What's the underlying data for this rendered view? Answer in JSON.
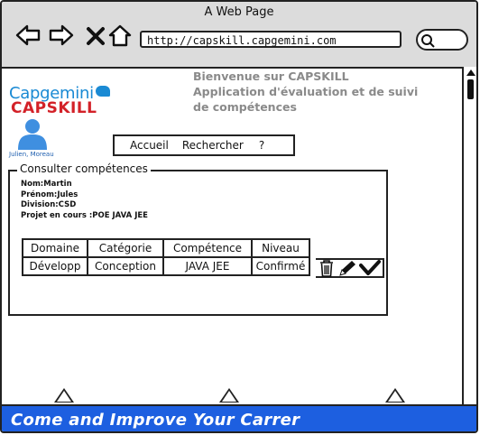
{
  "window": {
    "title": "A Web Page"
  },
  "browser": {
    "url": "http://capskill.capgemini.com"
  },
  "brand": {
    "logo_top": "Capgemini",
    "logo_bottom": "CAPSKILL"
  },
  "welcome": {
    "line1": "Bienvenue sur CAPSKILL",
    "line2": "Application d'évaluation et de suivi",
    "line3": "de compétences"
  },
  "user": {
    "name": "Julien, Moreau"
  },
  "menu": {
    "home": "Accueil",
    "search": "Rechercher",
    "help": "?"
  },
  "section": {
    "title": "Consulter compétences",
    "nom": "Nom:Martin",
    "prenom": "Prénom:Jules",
    "division": "Division:CSD",
    "projet": "Projet en cours :POE JAVA JEE"
  },
  "table": {
    "headers": [
      "Domaine",
      "Catégorie",
      "Compétence",
      "Niveau"
    ],
    "rows": [
      [
        "Développ",
        "Conception",
        "JAVA JEE",
        "Confirmé"
      ]
    ]
  },
  "footer": {
    "text": "Come and Improve Your Carrer"
  },
  "colors": {
    "accent_blue": "#1d5fe0",
    "brand_blue": "#1a8ad4",
    "brand_red": "#d32128"
  }
}
